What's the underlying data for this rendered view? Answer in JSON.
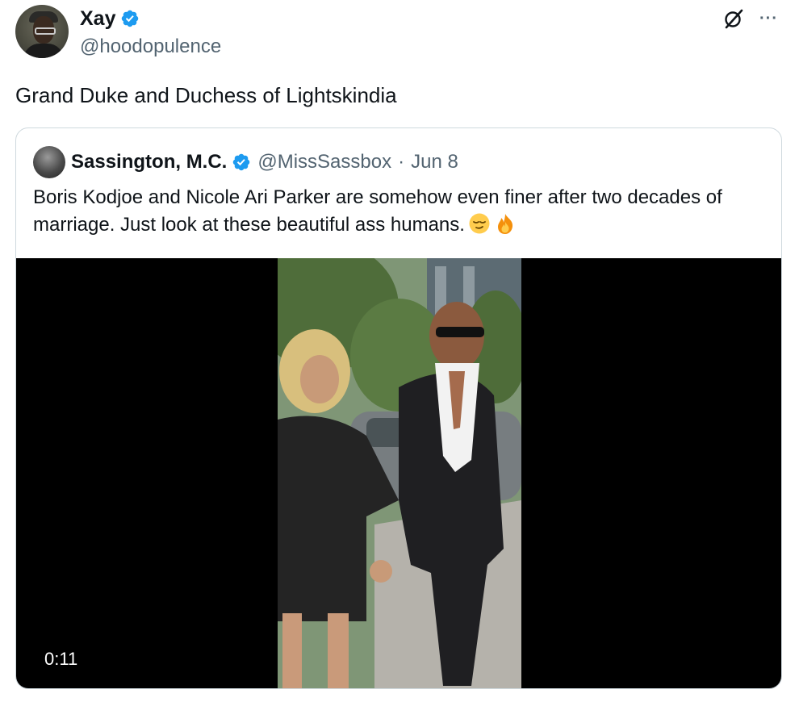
{
  "author": {
    "name": "Xay",
    "handle": "@hoodopulence",
    "verified_color": "#1d9bf0"
  },
  "tweet": {
    "text": "Grand Duke and Duchess of Lightskindia"
  },
  "header_actions": {
    "grok_icon": "grok-icon",
    "more_label": "···"
  },
  "quote": {
    "name": "Sassington, M.C.",
    "handle": "@MissSassbox",
    "separator": "·",
    "date": "Jun 8",
    "text": "Boris Kodjoe and Nicole Ari Parker are somehow even finer after two decades of marriage. Just look at these beautiful ass humans.",
    "emojis": [
      "relieved-face-emoji",
      "fire-emoji"
    ],
    "video": {
      "duration": "0:11"
    }
  }
}
